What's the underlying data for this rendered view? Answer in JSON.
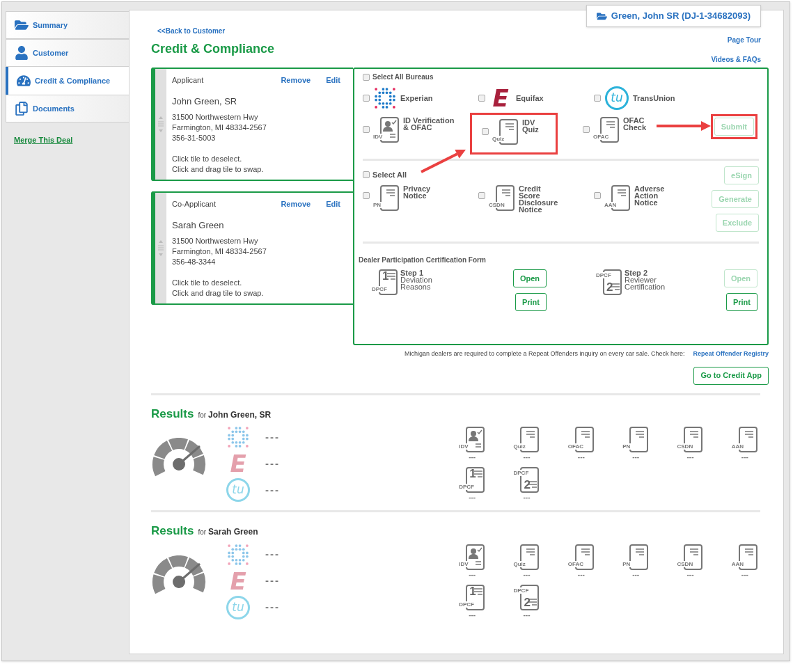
{
  "sidebar": {
    "tabs": [
      {
        "label": "Summary",
        "kind": "folder",
        "selected": false
      },
      {
        "label": "Customer",
        "kind": "person",
        "selected": false
      },
      {
        "label": "Credit & Compliance",
        "kind": "gauge",
        "selected": true
      },
      {
        "label": "Documents",
        "kind": "documents",
        "selected": false
      }
    ],
    "merge_link": "Merge This Deal"
  },
  "header": {
    "back_link": "<<Back to Customer",
    "title": "Credit & Compliance",
    "customer": "Green, John SR (DJ-1-34682093)",
    "links": [
      "Page Tour",
      "Videos & FAQs"
    ]
  },
  "applicants": [
    {
      "role": "Applicant",
      "actions": [
        "Remove",
        "Edit"
      ],
      "name": "John Green, SR",
      "address": [
        "31500 Northwestern Hwy",
        "Farmington, MI 48334-2567",
        "356-31-5003"
      ],
      "hints": [
        "Click tile to deselect.",
        "Click and drag tile to swap."
      ]
    },
    {
      "role": "Co-Applicant",
      "actions": [
        "Remove",
        "Edit"
      ],
      "name": "Sarah Green",
      "address": [
        "31500 Northwestern Hwy",
        "Farmington, MI 48334-2567",
        "356-48-3344"
      ],
      "hints": [
        "Click tile to deselect.",
        "Click and drag tile to swap."
      ]
    }
  ],
  "bureaus": {
    "select_all": {
      "label": "Select All Bureaus",
      "checked": false
    },
    "items": [
      {
        "kind": "experian",
        "label": "Experian",
        "checked": false
      },
      {
        "kind": "equifax",
        "logo": "E",
        "label": "Equifax",
        "checked": false
      },
      {
        "kind": "transunion",
        "logo": "tu",
        "label": "TransUnion",
        "checked": false
      }
    ]
  },
  "verification": {
    "items": [
      {
        "kind": "person",
        "tag": "IDV",
        "lines": [
          "ID Verification",
          "& OFAC"
        ],
        "checked": false,
        "highlighted": false
      },
      {
        "kind": "lines",
        "tag": "Quiz",
        "lines": [
          "IDV",
          "Quiz"
        ],
        "checked": false,
        "highlighted": true
      },
      {
        "kind": "lines",
        "tag": "OFAC",
        "lines": [
          "OFAC",
          "Check"
        ],
        "checked": false,
        "highlighted": false
      }
    ],
    "submit": {
      "label": "Submit",
      "disabled": true,
      "highlighted": true
    }
  },
  "notices": {
    "select_all": {
      "label": "Select All",
      "checked": false
    },
    "items": [
      {
        "kind": "lines",
        "tag": "PN",
        "lines": [
          "Privacy",
          "Notice"
        ],
        "checked": false
      },
      {
        "kind": "lines",
        "tag": "CSDN",
        "lines": [
          "Credit",
          "Score",
          "Disclosure",
          "Notice"
        ],
        "checked": false
      },
      {
        "kind": "lines",
        "tag": "AAN",
        "lines": [
          "Adverse",
          "Action",
          "Notice"
        ],
        "checked": false
      }
    ],
    "buttons": [
      {
        "label": "eSign",
        "disabled": true
      },
      {
        "label": "Generate",
        "disabled": true
      },
      {
        "label": "Exclude",
        "disabled": true
      }
    ]
  },
  "dpcf": {
    "title": "Dealer Participation Certification Form",
    "steps": [
      {
        "kind": "digit_first",
        "digit": "1",
        "tag": "DPCF",
        "step": "Step 1",
        "lines": [
          "Deviation",
          "Reasons"
        ],
        "buttons": [
          {
            "label": "Open",
            "disabled": false
          },
          {
            "label": "Print",
            "disabled": false
          }
        ]
      },
      {
        "kind": "tag_first",
        "digit": "2",
        "tag": "DPCF",
        "step": "Step 2",
        "lines": [
          "Reviewer",
          "Certification"
        ],
        "buttons": [
          {
            "label": "Open",
            "disabled": true
          },
          {
            "label": "Print",
            "disabled": false
          }
        ]
      }
    ]
  },
  "registry": {
    "text": "Michigan dealers are required to complete a Repeat Offenders inquiry on every car sale. Check here:",
    "link": "Repeat Offender Registry"
  },
  "credit_app_button": "Go to Credit App",
  "results": [
    {
      "title": "Results",
      "prefix": "for",
      "name": "John Green, SR",
      "bureaus": [
        {
          "kind": "experian",
          "value": "---"
        },
        {
          "kind": "equifax",
          "logo": "E",
          "value": "---"
        },
        {
          "kind": "transunion",
          "logo": "tu",
          "value": "---"
        }
      ],
      "documents": [
        {
          "kind": "person",
          "tag": "IDV",
          "value": "---"
        },
        {
          "kind": "lines",
          "tag": "Quiz",
          "value": "---"
        },
        {
          "kind": "lines",
          "tag": "OFAC",
          "value": "---"
        },
        {
          "kind": "lines",
          "tag": "PN",
          "value": "---"
        },
        {
          "kind": "lines",
          "tag": "CSDN",
          "value": "---"
        },
        {
          "kind": "lines",
          "tag": "AAN",
          "value": "---"
        },
        {
          "kind": "digit_first",
          "digit": "1",
          "tag": "DPCF",
          "value": "---"
        },
        {
          "kind": "tag_first",
          "digit": "2",
          "tag": "DPCF",
          "value": "---"
        }
      ]
    },
    {
      "title": "Results",
      "prefix": "for",
      "name": "Sarah Green",
      "bureaus": [
        {
          "kind": "experian",
          "value": "---"
        },
        {
          "kind": "equifax",
          "logo": "E",
          "value": "---"
        },
        {
          "kind": "transunion",
          "logo": "tu",
          "value": "---"
        }
      ],
      "documents": [
        {
          "kind": "person",
          "tag": "IDV",
          "value": "---"
        },
        {
          "kind": "lines",
          "tag": "Quiz",
          "value": "---"
        },
        {
          "kind": "lines",
          "tag": "OFAC",
          "value": "---"
        },
        {
          "kind": "lines",
          "tag": "PN",
          "value": "---"
        },
        {
          "kind": "lines",
          "tag": "CSDN",
          "value": "---"
        },
        {
          "kind": "lines",
          "tag": "AAN",
          "value": "---"
        },
        {
          "kind": "digit_first",
          "digit": "1",
          "tag": "DPCF",
          "value": "---"
        },
        {
          "kind": "tag_first",
          "digit": "2",
          "tag": "DPCF",
          "value": "---"
        }
      ]
    }
  ]
}
